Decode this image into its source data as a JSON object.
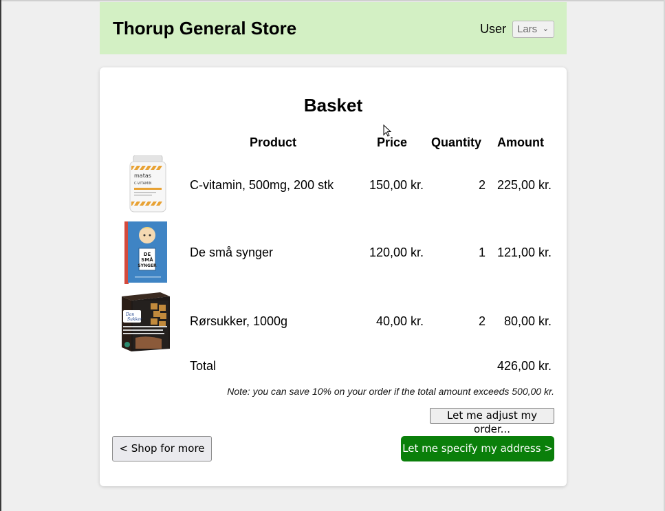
{
  "header": {
    "store_name": "Thorup General Store",
    "user_label": "User",
    "user_selected": "Lars"
  },
  "basket": {
    "title": "Basket",
    "columns": {
      "product": "Product",
      "price": "Price",
      "quantity": "Quantity",
      "amount": "Amount"
    },
    "items": [
      {
        "name": "C-vitamin, 500mg, 200 stk",
        "price": "150,00 kr.",
        "quantity": "2",
        "amount": "225,00 kr.",
        "image_icon": "vitamin-jar-image",
        "image_text": [
          "matas",
          "C-VITAMIN"
        ]
      },
      {
        "name": "De små synger",
        "price": "120,00 kr.",
        "quantity": "1",
        "amount": "121,00 kr.",
        "image_icon": "songbook-cover-image",
        "image_text": [
          "DE",
          "SMÅ",
          "SYNGER"
        ]
      },
      {
        "name": "Rørsukker, 1000g",
        "price": "40,00 kr.",
        "quantity": "2",
        "amount": "80,00 kr.",
        "image_icon": "sugar-box-image",
        "image_text": [
          "Dan",
          "Sukker"
        ]
      }
    ],
    "total_label": "Total",
    "total_value": "426,00 kr.",
    "note": "Note: you can save 10% on your order if the total amount exceeds 500,00 kr."
  },
  "actions": {
    "adjust_order": "Let me adjust my order...",
    "shop_more": "< Shop for more",
    "specify_address": "Let me specify my address >"
  },
  "colors": {
    "header_bg": "#d3f0c4",
    "primary_button": "#0a7f0a",
    "page_bg": "#efefef"
  }
}
